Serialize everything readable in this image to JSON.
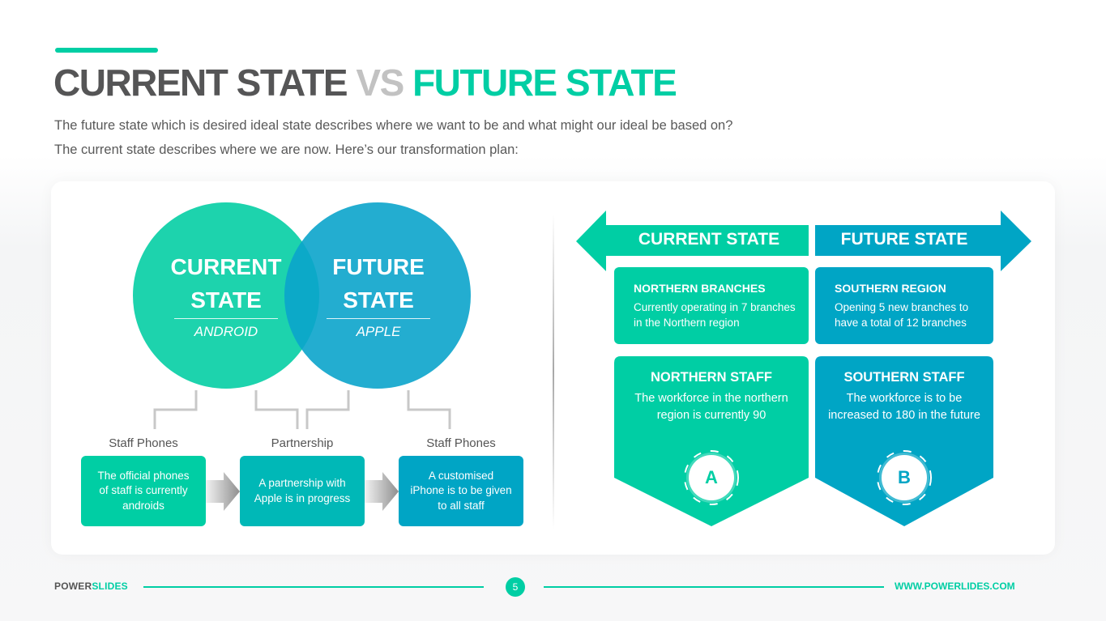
{
  "header": {
    "title_part1": "CURRENT STATE",
    "title_part2": "VS",
    "title_part3": "FUTURE STATE",
    "subtitle_line1": "The future state which is desired ideal state describes where we want to be and what might our ideal be based on?",
    "subtitle_line2": "The current state describes where we are now. Here’s our transformation plan:"
  },
  "venn": {
    "left": {
      "line1": "CURRENT",
      "line2": "STATE",
      "sub": "ANDROID",
      "color": "#1dd3ad"
    },
    "right": {
      "line1": "FUTURE",
      "line2": "STATE",
      "sub": "APPLE",
      "color": "#0ba4cb"
    }
  },
  "phases": [
    {
      "label": "Staff Phones",
      "text": "The official phones of staff is currently androids",
      "color": "#00cea4"
    },
    {
      "label": "Partnership",
      "text": "A partnership with Apple is in progress",
      "color": "#00b8b7"
    },
    {
      "label": "Staff Phones",
      "text": "A customised iPhone is to be given to all staff",
      "color": "#00a5c5"
    }
  ],
  "comparison": {
    "current_banner": "CURRENT STATE",
    "future_banner": "FUTURE STATE",
    "current_color": "#00cea4",
    "future_color": "#00a5c5",
    "boxes": [
      {
        "title": "NORTHERN BRANCHES",
        "text": "Currently operating in 7 branches in the Northern region"
      },
      {
        "title": "SOUTHERN REGION",
        "text": "Opening 5 new branches to have a total of 12 branches"
      }
    ],
    "staff": [
      {
        "title": "NORTHERN STAFF",
        "text": "The workforce in the northern region is currently 90",
        "badge": "A"
      },
      {
        "title": "SOUTHERN STAFF",
        "text": "The workforce is to be increased to 180 in the future",
        "badge": "B"
      }
    ]
  },
  "footer": {
    "brand_part1": "POWER",
    "brand_part2": "SLIDES",
    "page_number": "5",
    "url": "WWW.POWERLIDES.COM"
  }
}
